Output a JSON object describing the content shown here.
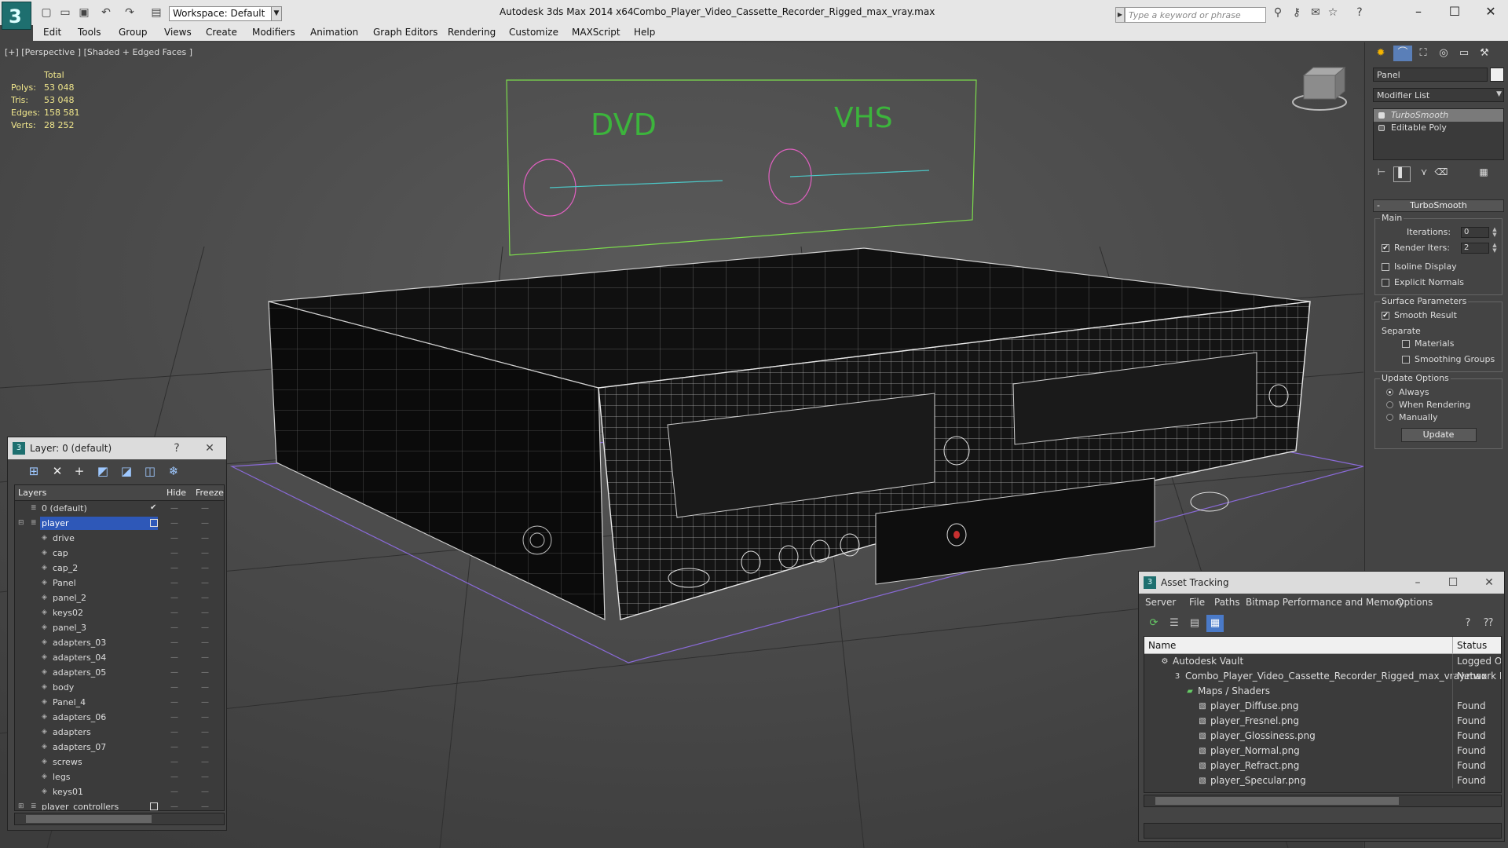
{
  "titlebar": {
    "workspace": "Workspace: Default",
    "app": "Autodesk 3ds Max  2014 x64",
    "file": "Combo_Player_Video_Cassette_Recorder_Rigged_max_vray.max",
    "search_placeholder": "Type a keyword or phrase"
  },
  "menu": [
    "Edit",
    "Tools",
    "Group",
    "Views",
    "Create",
    "Modifiers",
    "Animation",
    "Graph Editors",
    "Rendering",
    "Customize",
    "MAXScript",
    "Help"
  ],
  "viewport": {
    "label": "[+] [Perspective ] [Shaded + Edged Faces ]",
    "stats": {
      "header": "Total",
      "rows": [
        {
          "k": "Polys:",
          "v": "53 048"
        },
        {
          "k": "Tris:",
          "v": "53 048"
        },
        {
          "k": "Edges:",
          "v": "158 581"
        },
        {
          "k": "Verts:",
          "v": "28 252"
        }
      ]
    },
    "panel_labels": {
      "dvd": "DVD",
      "vhs": "VHS"
    }
  },
  "command_panel": {
    "object_name": "Panel",
    "modifier_list": "Modifier List",
    "stack": [
      "TurboSmooth",
      "Editable Poly"
    ],
    "turbosmooth": {
      "title": "TurboSmooth",
      "main": "Main",
      "iterations_label": "Iterations:",
      "iterations": "0",
      "render_iters_label": "Render Iters:",
      "render_iters": "2",
      "isoline": "Isoline Display",
      "explicit_normals": "Explicit Normals",
      "surface_params": "Surface Parameters",
      "smooth_result": "Smooth Result",
      "separate": "Separate",
      "materials": "Materials",
      "smoothing_groups": "Smoothing Groups",
      "update_options": "Update Options",
      "always": "Always",
      "when_rendering": "When Rendering",
      "manually": "Manually",
      "update": "Update"
    }
  },
  "layer_window": {
    "title": "Layer: 0 (default)",
    "col_layers": "Layers",
    "col_hide": "Hide",
    "col_freeze": "Freeze",
    "rows": [
      {
        "name": "0 (default)",
        "level": 0
      },
      {
        "name": "player",
        "level": 0
      },
      {
        "name": "drive",
        "level": 1
      },
      {
        "name": "cap",
        "level": 1
      },
      {
        "name": "cap_2",
        "level": 1
      },
      {
        "name": "Panel",
        "level": 1
      },
      {
        "name": "panel_2",
        "level": 1
      },
      {
        "name": "keys02",
        "level": 1
      },
      {
        "name": "panel_3",
        "level": 1
      },
      {
        "name": "adapters_03",
        "level": 1
      },
      {
        "name": "adapters_04",
        "level": 1
      },
      {
        "name": "adapters_05",
        "level": 1
      },
      {
        "name": "body",
        "level": 1
      },
      {
        "name": "Panel_4",
        "level": 1
      },
      {
        "name": "adapters_06",
        "level": 1
      },
      {
        "name": "adapters",
        "level": 1
      },
      {
        "name": "adapters_07",
        "level": 1
      },
      {
        "name": "screws",
        "level": 1
      },
      {
        "name": "legs",
        "level": 1
      },
      {
        "name": "keys01",
        "level": 1
      },
      {
        "name": "player_controllers",
        "level": 0
      }
    ]
  },
  "asset_window": {
    "title": "Asset Tracking",
    "menu": [
      "Server",
      "File",
      "Paths",
      "Bitmap Performance and Memory",
      "Options"
    ],
    "col_name": "Name",
    "col_status": "Status",
    "rows": [
      {
        "name": "Autodesk Vault",
        "status": "Logged Out",
        "level": 0
      },
      {
        "name": "Combo_Player_Video_Cassette_Recorder_Rigged_max_vray.max",
        "status": "Network P",
        "level": 1
      },
      {
        "name": "Maps / Shaders",
        "status": "",
        "level": 2
      },
      {
        "name": "player_Diffuse.png",
        "status": "Found",
        "level": 3
      },
      {
        "name": "player_Fresnel.png",
        "status": "Found",
        "level": 3
      },
      {
        "name": "player_Glossiness.png",
        "status": "Found",
        "level": 3
      },
      {
        "name": "player_Normal.png",
        "status": "Found",
        "level": 3
      },
      {
        "name": "player_Refract.png",
        "status": "Found",
        "level": 3
      },
      {
        "name": "player_Specular.png",
        "status": "Found",
        "level": 3
      }
    ]
  },
  "colors": {
    "selection": "#2e58b8",
    "stats": "#f0e68c",
    "wire": "#e8e8e8",
    "helper": "#7cdc4c"
  }
}
